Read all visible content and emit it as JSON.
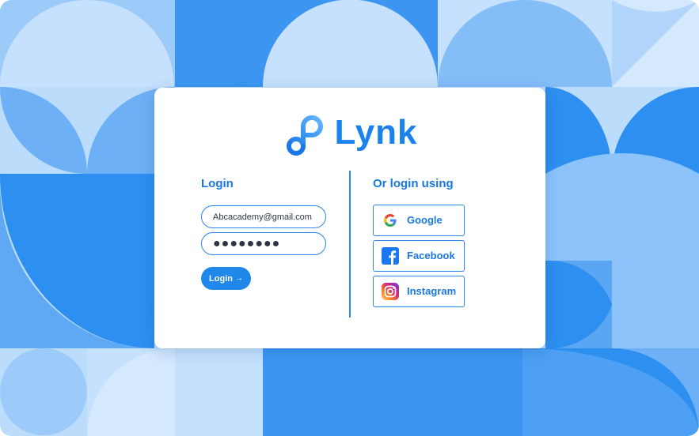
{
  "brand": {
    "name": "Lynk",
    "color": "#1a82ea"
  },
  "login": {
    "title": "Login",
    "email_value": "Abcacademy@gmail.com",
    "password_value": "●●●●●●●●",
    "button_label": "Login",
    "button_arrow": "→"
  },
  "social": {
    "title": "Or login using",
    "google_label": "Google",
    "facebook_label": "Facebook",
    "instagram_label": "Instagram"
  },
  "colors": {
    "accent": "#1f88ea",
    "bg_light": "#bcdcfc",
    "bg_mid": "#8cc3fa",
    "bg_dark": "#2d8ff0"
  }
}
